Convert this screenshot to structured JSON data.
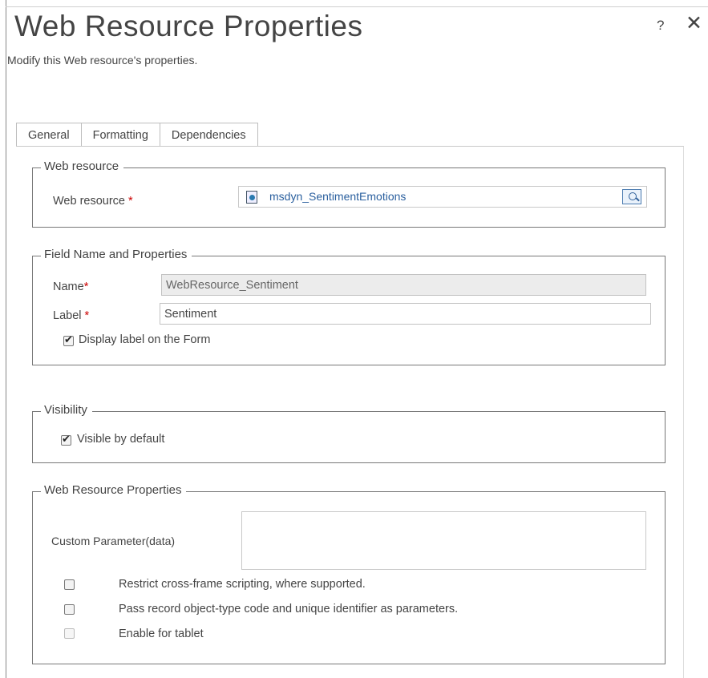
{
  "dialog": {
    "title": "Web Resource Properties",
    "subtitle": "Modify this Web resource's properties.",
    "help_label": "?",
    "close_label": "✕"
  },
  "tabs": [
    {
      "label": "General",
      "active": true
    },
    {
      "label": "Formatting",
      "active": false
    },
    {
      "label": "Dependencies",
      "active": false
    }
  ],
  "web_resource_group": {
    "legend": "Web resource",
    "field_label": "Web resource",
    "required_mark": "*",
    "value": "msdyn_SentimentEmotions"
  },
  "field_group": {
    "legend": "Field Name and Properties",
    "name_label": "Name",
    "name_value": "WebResource_Sentiment",
    "label_label": "Label",
    "label_value": "Sentiment",
    "required_mark": "*",
    "display_label_text": "Display label on the Form",
    "display_label_checked": true
  },
  "visibility_group": {
    "legend": "Visibility",
    "visible_text": "Visible by default",
    "visible_checked": true
  },
  "properties_group": {
    "legend": "Web Resource Properties",
    "custom_param_label": "Custom Parameter(data)",
    "custom_param_value": "",
    "options": [
      {
        "label": "Restrict cross-frame scripting, where supported.",
        "checked": false,
        "enabled": true
      },
      {
        "label": "Pass record object-type code and unique identifier as parameters.",
        "checked": false,
        "enabled": true
      },
      {
        "label": "Enable for tablet",
        "checked": false,
        "enabled": false
      }
    ]
  }
}
